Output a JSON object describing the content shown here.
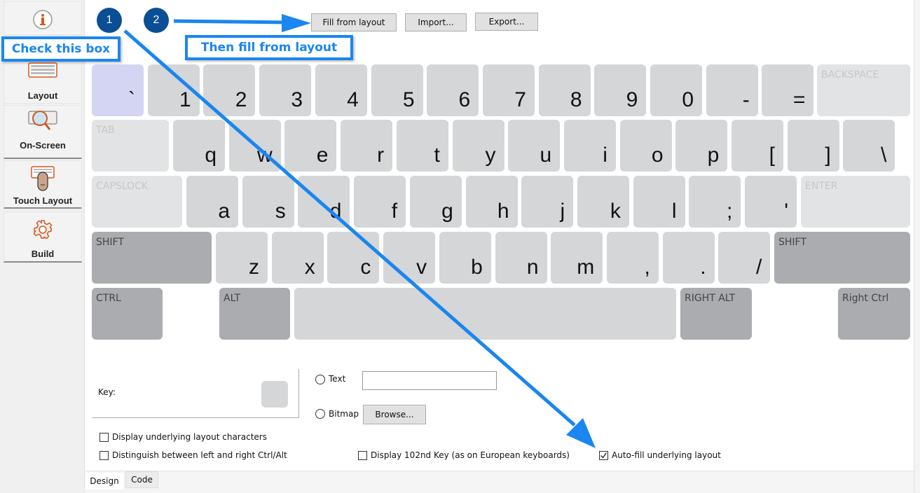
{
  "sidebar": {
    "items": [
      {
        "label": "",
        "icon": "info-icon"
      },
      {
        "label": "Layout",
        "icon": "keyboard-icon"
      },
      {
        "label": "On-Screen",
        "icon": "keyboard-magnifier-icon"
      },
      {
        "label": "Touch Layout",
        "icon": "touch-keyboard-icon"
      },
      {
        "label": "Build",
        "icon": "gear-icon"
      }
    ]
  },
  "toolbar": {
    "fill_label": "Fill from layout",
    "import_label": "Import...",
    "export_label": "Export..."
  },
  "annotations": {
    "step1_number": "1",
    "step2_number": "2",
    "step1_text": "Check this box",
    "step2_text": "Then fill from layout",
    "accent_color": "#1a86f0",
    "badge_color": "#0a4f95"
  },
  "keyboard": {
    "row1": [
      "`",
      "1",
      "2",
      "3",
      "4",
      "5",
      "6",
      "7",
      "8",
      "9",
      "0",
      "-",
      "="
    ],
    "row1_special": "BACKSPACE",
    "row2_special": "TAB",
    "row2": [
      "q",
      "w",
      "e",
      "r",
      "t",
      "y",
      "u",
      "i",
      "o",
      "p",
      "[",
      "]",
      "\\"
    ],
    "row3_special": "CAPSLOCK",
    "row3": [
      "a",
      "s",
      "d",
      "f",
      "g",
      "h",
      "j",
      "k",
      "l",
      ";",
      "'"
    ],
    "row3_end": "ENTER",
    "row4_left": "SHIFT",
    "row4": [
      "z",
      "x",
      "c",
      "v",
      "b",
      "n",
      "m",
      ",",
      ".",
      "/"
    ],
    "row4_right": "SHIFT",
    "row5": {
      "ctrl": "CTRL",
      "alt": "ALT",
      "space": "",
      "right_alt": "RIGHT ALT",
      "right_ctrl": "Right Ctrl"
    },
    "selected_key": "`"
  },
  "key_editor": {
    "key_label": "Key:",
    "text_option": "Text",
    "text_value": "",
    "bitmap_option": "Bitmap",
    "browse_label": "Browse..."
  },
  "options": {
    "display_underlying": {
      "label": "Display underlying layout characters",
      "checked": false
    },
    "distinguish_ctrl_alt": {
      "label": "Distinguish between left and right Ctrl/Alt",
      "checked": false
    },
    "display_102nd": {
      "label": "Display 102nd Key (as on European keyboards)",
      "checked": false
    },
    "auto_fill": {
      "label": "Auto-fill underlying layout",
      "checked": true
    }
  },
  "tabs": [
    {
      "label": "Design",
      "active": true
    },
    {
      "label": "Code",
      "active": false
    }
  ]
}
